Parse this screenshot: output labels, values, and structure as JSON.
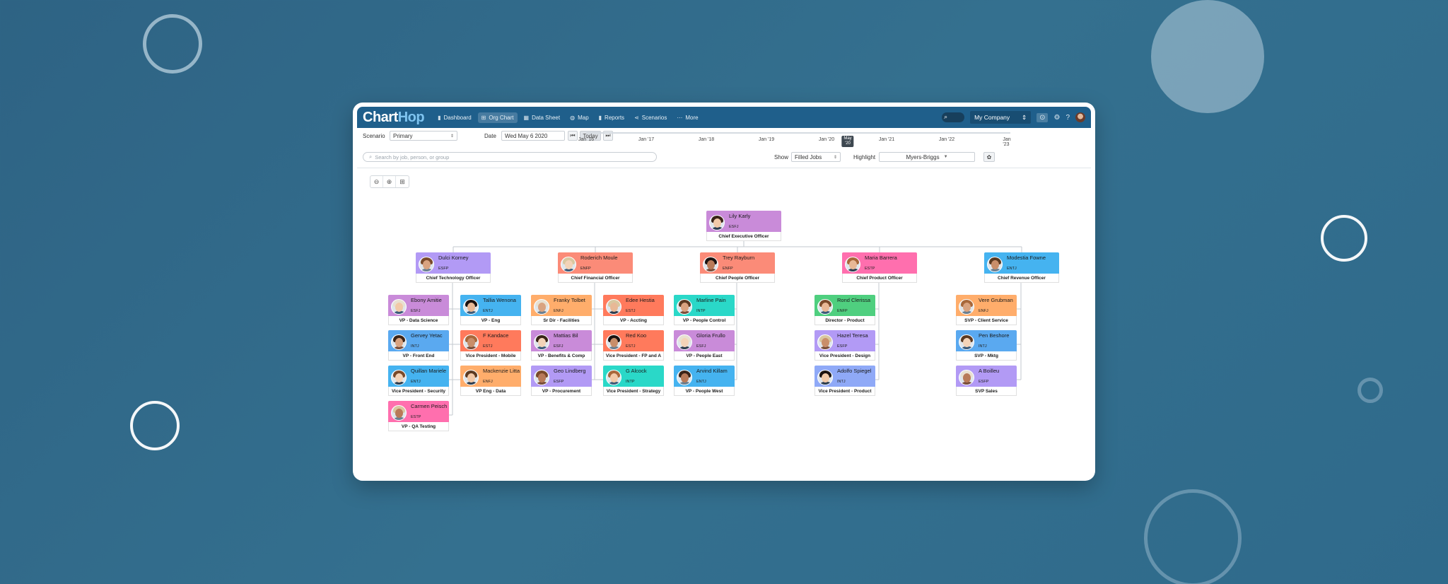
{
  "app": {
    "logo_main": "Chart",
    "logo_accent": "Hop"
  },
  "nav": [
    {
      "label": "Dashboard",
      "icon": "bar-chart-icon",
      "glyph": "▮"
    },
    {
      "label": "Org Chart",
      "icon": "org-chart-icon",
      "glyph": "⊞",
      "active": true
    },
    {
      "label": "Data Sheet",
      "icon": "table-icon",
      "glyph": "▦"
    },
    {
      "label": "Map",
      "icon": "globe-icon",
      "glyph": "◍"
    },
    {
      "label": "Reports",
      "icon": "reports-icon",
      "glyph": "▮"
    },
    {
      "label": "Scenarios",
      "icon": "scenarios-icon",
      "glyph": "⋖"
    },
    {
      "label": "More",
      "icon": "more-icon",
      "glyph": "⋯"
    }
  ],
  "topbar": {
    "company": "My Company"
  },
  "controls": {
    "scenario_label": "Scenario",
    "scenario_value": "Primary",
    "date_label": "Date",
    "date_value": "Wed May 6 2020",
    "today_label": "Today",
    "search_placeholder": "Search by job, person, or group",
    "show_label": "Show",
    "show_value": "Filled Jobs",
    "highlight_label": "Highlight",
    "highlight_value": "Myers-Briggs"
  },
  "timeline": {
    "ticks": [
      "Jan '16",
      "Jan '17",
      "Jan '18",
      "Jan '19",
      "Jan '20",
      "Jan '21",
      "Jan '22",
      "Jan '23"
    ],
    "current_line1": "May",
    "current_line2": "'20"
  },
  "colors": {
    "purple": "#c98bd9",
    "violet": "#b29af5",
    "salmon": "#fb8b78",
    "orange": "#ff7a5c",
    "pink": "#ff6fae",
    "blue": "#5aa9f0",
    "skyblue": "#45b3f0",
    "teal": "#2ad8c8",
    "green": "#4fcf7f",
    "peach": "#ffad6b",
    "periwinkle": "#8fa9f7"
  },
  "people": [
    {
      "id": "ceo",
      "name": "Lily Karly",
      "mb": "ESFJ",
      "title": "Chief Executive Officer",
      "color": "#c98bd9"
    },
    {
      "id": "cto",
      "name": "Dulci Korney",
      "mb": "ESFP",
      "title": "Chief Technology Officer",
      "color": "#b29af5"
    },
    {
      "id": "cfo",
      "name": "Roderich Moule",
      "mb": "ENFP",
      "title": "Chief Financial Officer",
      "color": "#fb8b78"
    },
    {
      "id": "cpo",
      "name": "Trey Rayburn",
      "mb": "ENFP",
      "title": "Chief People Officer",
      "color": "#fb8b78"
    },
    {
      "id": "cpro",
      "name": "Maria Barrera",
      "mb": "ESTP",
      "title": "Chief Product Officer",
      "color": "#ff6fae"
    },
    {
      "id": "cro",
      "name": "Modestia Fowne",
      "mb": "ENTJ",
      "title": "Chief Revenue Officer",
      "color": "#45b3f0"
    },
    {
      "id": "p1",
      "name": "Ebony Amitie",
      "mb": "ESFJ",
      "title": "VP - Data Science",
      "color": "#c98bd9"
    },
    {
      "id": "p2",
      "name": "Gervey Yetac",
      "mb": "INTJ",
      "title": "VP - Front End",
      "color": "#5aa9f0"
    },
    {
      "id": "p3",
      "name": "Quillan Mariele",
      "mb": "ENTJ",
      "title": "Vice President - Security",
      "color": "#45b3f0"
    },
    {
      "id": "p4",
      "name": "Carmen Peisch",
      "mb": "ESTP",
      "title": "VP - QA Testing",
      "color": "#ff6fae"
    },
    {
      "id": "p5",
      "name": "Tallia Wenona",
      "mb": "ENTJ",
      "title": "VP - Eng",
      "color": "#45b3f0"
    },
    {
      "id": "p6",
      "name": "F Kandace",
      "mb": "ESTJ",
      "title": "Vice President - Mobile",
      "color": "#ff7a5c"
    },
    {
      "id": "p7",
      "name": "Mackenzie Litta",
      "mb": "ENFJ",
      "title": "VP Eng - Data",
      "color": "#ffad6b"
    },
    {
      "id": "p8",
      "name": "Franky Tolbet",
      "mb": "ENFJ",
      "title": "Sr Dir - Facilities",
      "color": "#ffad6b"
    },
    {
      "id": "p9",
      "name": "Mattias Bil",
      "mb": "ESFJ",
      "title": "VP - Benefits & Comp",
      "color": "#c98bd9"
    },
    {
      "id": "p10",
      "name": "Geo Lindberg",
      "mb": "ESFP",
      "title": "VP - Procurement",
      "color": "#b29af5"
    },
    {
      "id": "p11",
      "name": "Edee Hestia",
      "mb": "ESTJ",
      "title": "VP - Accting",
      "color": "#ff7a5c"
    },
    {
      "id": "p12",
      "name": "Red Koo",
      "mb": "ESTJ",
      "title": "Vice President - FP and A",
      "color": "#ff7a5c"
    },
    {
      "id": "p13",
      "name": "G Alcock",
      "mb": "INTP",
      "title": "Vice President - Strategy",
      "color": "#2ad8c8"
    },
    {
      "id": "p14",
      "name": "Marline Pain",
      "mb": "INTP",
      "title": "VP - People Control",
      "color": "#2ad8c8"
    },
    {
      "id": "p15",
      "name": "Gloria Frullo",
      "mb": "ESFJ",
      "title": "VP - People East",
      "color": "#c98bd9"
    },
    {
      "id": "p16",
      "name": "Arvind Killam",
      "mb": "ENTJ",
      "title": "VP - People West",
      "color": "#45b3f0"
    },
    {
      "id": "p17",
      "name": "Rond Clerissa",
      "mb": "ENFP",
      "title": "Director - Product",
      "color": "#4fcf7f"
    },
    {
      "id": "p18",
      "name": "Hazel Teresa",
      "mb": "ESFP",
      "title": "Vice President - Design",
      "color": "#b29af5"
    },
    {
      "id": "p19",
      "name": "Adolfo Spiegel",
      "mb": "INTJ",
      "title": "Vice President - Product",
      "color": "#8fa9f7"
    },
    {
      "id": "p20",
      "name": "Vere Grubman",
      "mb": "ENFJ",
      "title": "SVP - Client Service",
      "color": "#ffad6b"
    },
    {
      "id": "p21",
      "name": "Pen Beshore",
      "mb": "INTJ",
      "title": "SVP - Mktg",
      "color": "#5aa9f0"
    },
    {
      "id": "p22",
      "name": "A Boilleu",
      "mb": "ESFP",
      "title": "SVP Sales",
      "color": "#b29af5"
    }
  ]
}
